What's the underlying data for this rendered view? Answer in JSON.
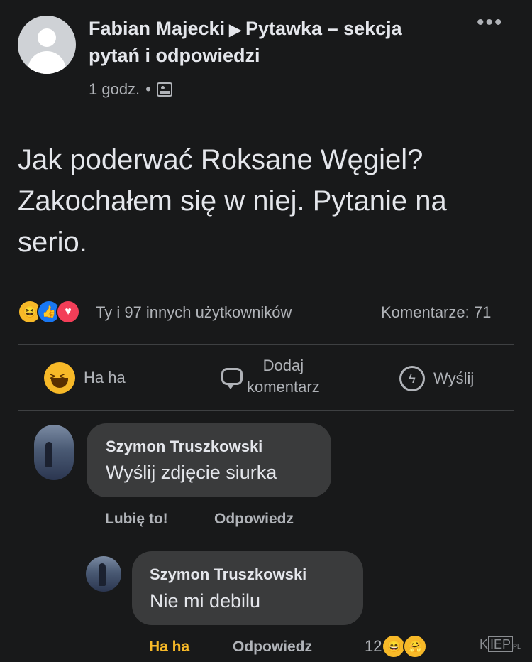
{
  "post": {
    "author": "Fabian Majecki",
    "separator_icon": "triangle-right-icon",
    "group": "Pytawka – sekcja pytań i odpowiedzi",
    "time": "1 godz.",
    "dot": "•",
    "audience_icon": "group-icon",
    "more": "•••",
    "text": "Jak poderwać Roksane Węgiel? Zakochałem się w niej. Pytanie na serio."
  },
  "reactions": {
    "icons": [
      "haha-icon",
      "like-icon",
      "love-icon"
    ],
    "summary": "Ty i 97 innych użytkowników",
    "comments": "Komentarze: 71"
  },
  "actions": {
    "haha": "Ha ha",
    "comment_line1": "Dodaj",
    "comment_line2": "komentarz",
    "send": "Wyślij"
  },
  "comments": [
    {
      "name": "Szymon Truszkowski",
      "text": "Wyślij zdjęcie siurka",
      "like": "Lubię to!",
      "reply": "Odpowiedz"
    },
    {
      "name": "Szymon Truszkowski",
      "text": "Nie mi debilu",
      "like": "Ha ha",
      "reply": "Odpowiedz",
      "reaction_count": "12"
    }
  ],
  "watermark": {
    "prefix": "K",
    "boxed": "IEP",
    "suffix": "PL"
  },
  "colors": {
    "background": "#18191a",
    "bubble": "#3a3b3c",
    "text": "#e4e6eb",
    "muted": "#b0b3b8",
    "haha": "#f7b928",
    "like": "#1877f2",
    "love": "#f33e58"
  }
}
